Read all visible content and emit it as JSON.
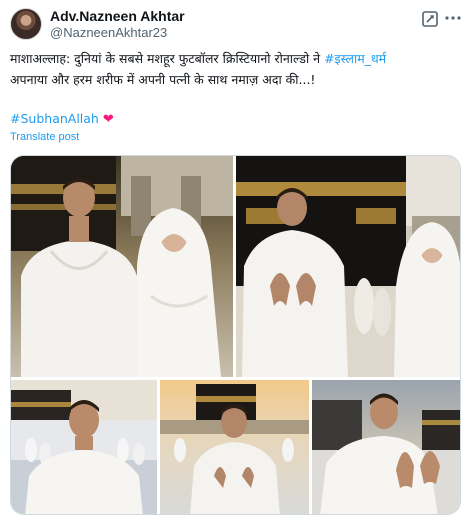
{
  "post": {
    "author": {
      "display_name": "Adv.Nazneen Akhtar",
      "handle": "@NazneenAkhtar23"
    },
    "text_plain_1": "माशाअल्लाह: दुनियां के सबसे मशहूर फुटबॉलर क्रिस्टियानो रोनाल्डो ने ",
    "hashtag_1": "#इस्लाम_धर्म",
    "text_line_2": "अपनाया और हरम शरीफ में अपनी पत्नी के साथ नमाज़ अदा की...!",
    "hashtag_2": "#SubhanAllah",
    "heart": "❤",
    "translate_link": "Translate post"
  },
  "icons": {
    "grok": "grok-icon",
    "more": "more-icon"
  },
  "colors": {
    "link": "#1d9bf0",
    "heart": "#f91880",
    "secondary_text": "#536471"
  }
}
